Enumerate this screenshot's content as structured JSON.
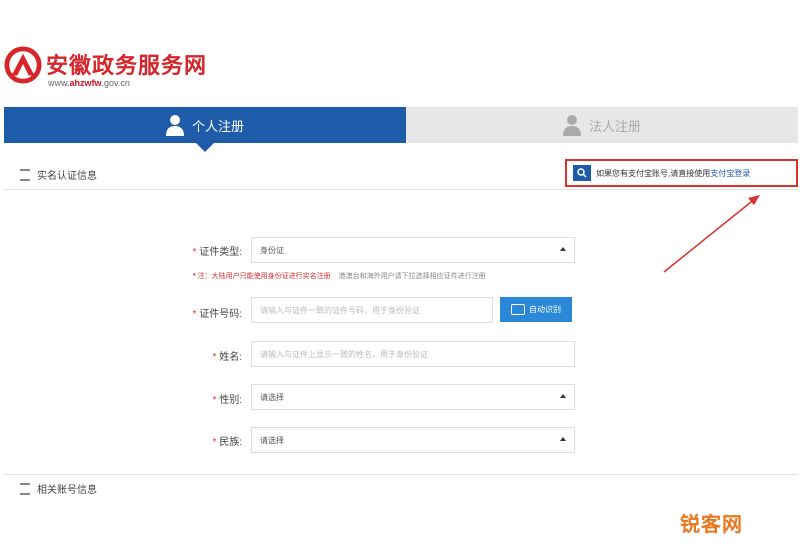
{
  "header": {
    "site_title": "安徽政务服务网",
    "site_url_prefix": "www.",
    "site_url_brand": "ahzwfw",
    ".gov.cn": ".gov.cn"
  },
  "tabs": [
    {
      "label": "个人注册",
      "active": true
    },
    {
      "label": "法人注册",
      "active": false
    }
  ],
  "sections": {
    "realname": "实名认证信息",
    "account": "相关账号信息"
  },
  "notice": {
    "text": "如果您有支付宝账号,请直接使用",
    "link": "支付宝登录"
  },
  "form": {
    "id_type": {
      "label": "证件类型:",
      "value": "身份证",
      "required": true
    },
    "hint_red": "注：大陆用户只能使用身份证进行实名注册",
    "hint_gray": "港澳台和海外用户请下拉选择相应证件进行注册",
    "id_number": {
      "label": "证件号码:",
      "placeholder": "请输入与证件一致的证件号码，用于身份验证",
      "required": true
    },
    "scan_button": "自动识别",
    "name": {
      "label": "姓名:",
      "placeholder": "请输入与证件上显示一致的姓名，用于身份验证"
    },
    "gender": {
      "label": "性别:",
      "value": "请选择"
    },
    "ethnicity": {
      "label": "民族:",
      "value": "请选择"
    }
  },
  "watermark": "锐客网",
  "colors": {
    "primary": "#1e5ba8",
    "brand_red": "#d7262a",
    "highlight_red": "#d9312e",
    "watermark_orange": "#e8761f"
  }
}
